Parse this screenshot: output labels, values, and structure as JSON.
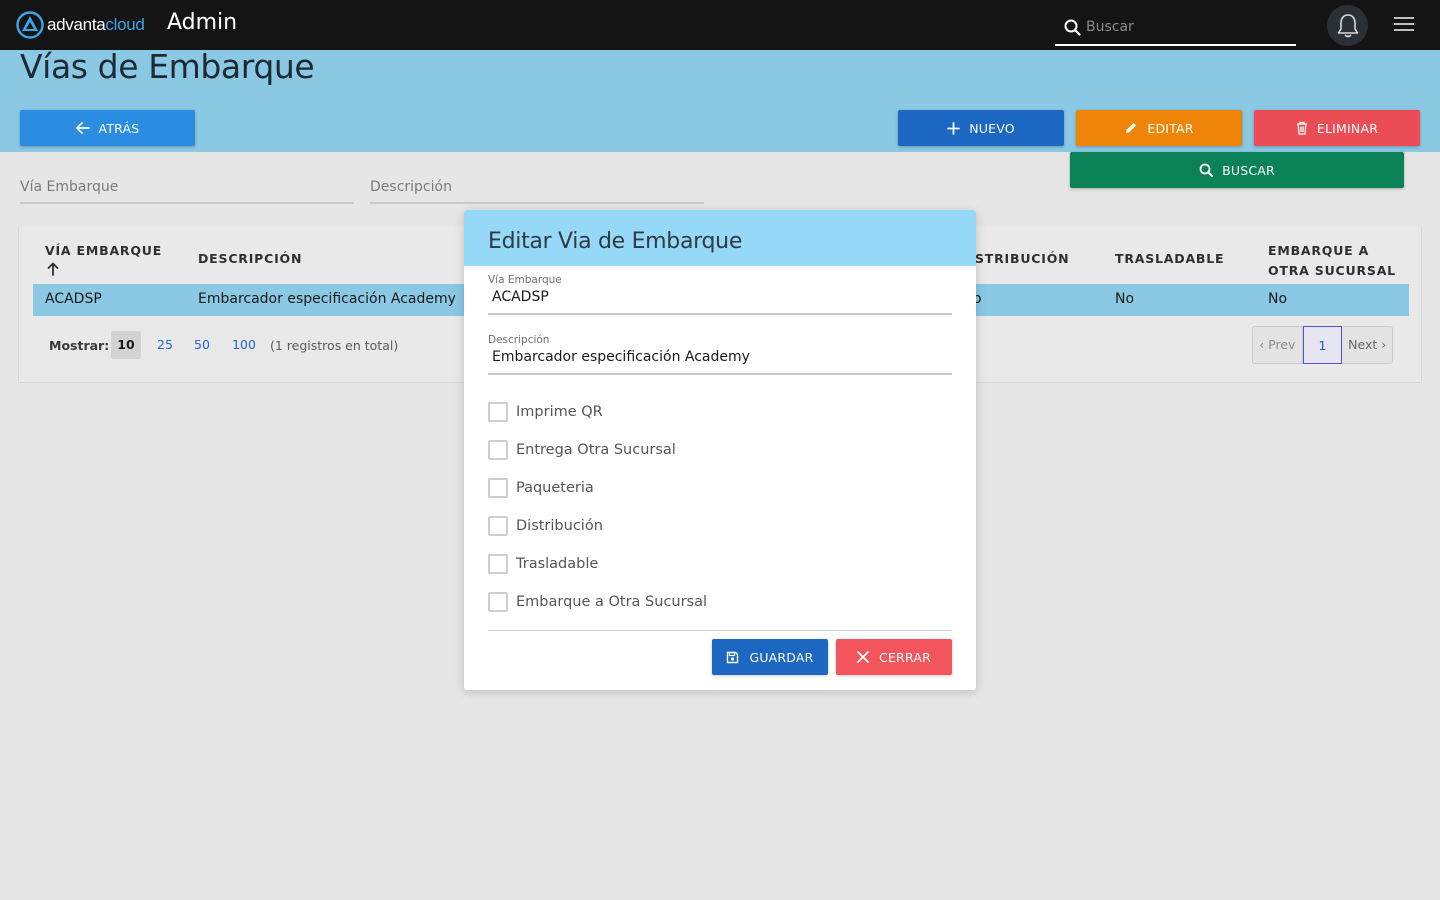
{
  "app": {
    "logo_text_primary": "advanta",
    "logo_text_secondary": "cloud",
    "section_title": "Admin",
    "search_placeholder": "Buscar"
  },
  "page": {
    "title": "Vías de Embarque"
  },
  "toolbar": {
    "back_label": "ATRÁS",
    "new_label": "NUEVO",
    "edit_label": "EDITAR",
    "delete_label": "ELIMINAR",
    "search_label": "BUSCAR"
  },
  "filters": {
    "via_placeholder": "Vía Embarque",
    "desc_placeholder": "Descripción"
  },
  "table": {
    "headers": {
      "via": "VÍA EMBARQUE",
      "desc": "DESCRIPCIÓN",
      "dist": "STRIBUCIÓN",
      "tras": "TRASLADABLE",
      "emb": "EMBARQUE A OTRA SUCURSAL"
    },
    "rows": [
      {
        "via": "ACADSP",
        "desc": "Embarcador especificación Academy",
        "dist": "o",
        "tras": "No",
        "emb": "No"
      }
    ]
  },
  "pagination": {
    "show_label": "Mostrar:",
    "sizes": [
      "10",
      "25",
      "50",
      "100"
    ],
    "active_size": "10",
    "total_text": "(1 registros en total)",
    "prev_label": "‹ Prev",
    "current_page": "1",
    "next_label": "Next ›"
  },
  "modal": {
    "title": "Editar Via de Embarque",
    "via_label": "Vía Embarque",
    "via_value": "ACADSP",
    "desc_label": "Descripción",
    "desc_value": "Embarcador especificación Academy",
    "checkboxes": [
      {
        "label": "Imprime QR",
        "checked": false
      },
      {
        "label": "Entrega Otra Sucursal",
        "checked": false
      },
      {
        "label": "Paqueteria",
        "checked": false
      },
      {
        "label": "Distribución",
        "checked": false
      },
      {
        "label": "Trasladable",
        "checked": false
      },
      {
        "label": "Embarque a Otra Sucursal",
        "checked": false
      }
    ],
    "save_label": "GUARDAR",
    "close_label": "CERRAR"
  },
  "colors": {
    "navbar": "#141414",
    "header_band": "#8ac8e4",
    "primary": "#1b67c2",
    "back": "#2b8de2",
    "edit": "#ef8508",
    "delete": "#ea4d55",
    "search": "#0a8157",
    "close": "#f2555b",
    "modal_header": "#95d8f7"
  }
}
